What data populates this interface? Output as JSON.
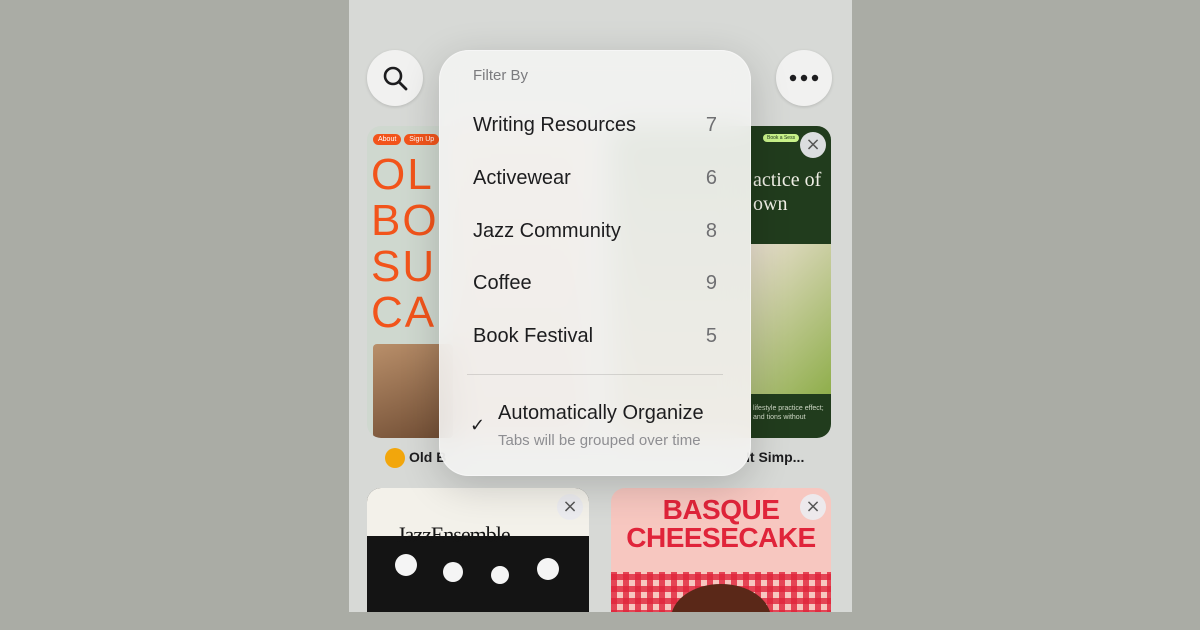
{
  "toolbar": {
    "search_icon": "search-icon",
    "more_icon": "ellipsis-icon"
  },
  "filter_menu": {
    "header": "Filter By",
    "items": [
      {
        "label": "Writing Resources",
        "count": "7"
      },
      {
        "label": "Activewear",
        "count": "6"
      },
      {
        "label": "Jazz Community",
        "count": "8"
      },
      {
        "label": "Coffee",
        "count": "9"
      },
      {
        "label": "Book Festival",
        "count": "5"
      }
    ],
    "auto_organize": {
      "checked": true,
      "title": "Automatically Organize",
      "subtitle": "Tabs will be grouped over time"
    }
  },
  "tabs": [
    {
      "title": "Old B",
      "thumb": {
        "chips": [
          "About",
          "Sign Up"
        ],
        "text": "OL BO SU CA"
      }
    },
    {
      "title": "It Simp...",
      "thumb": {
        "badge": "Book a Sess",
        "text": "actice of own",
        "body": "lifestyle practice effect; and tions without"
      }
    },
    {
      "title": "",
      "thumb": {
        "text": "JazzEnsemble"
      }
    },
    {
      "title": "",
      "thumb": {
        "text": "BASQUE CHEESECAKE"
      }
    }
  ],
  "colors": {
    "background": "#aaaca5",
    "accent_orange": "#f2541b",
    "jazz_bg": "#141414",
    "basque_red": "#e0243a",
    "basque_bg": "#f7c7c0",
    "green_dark": "#1f3a1b"
  }
}
